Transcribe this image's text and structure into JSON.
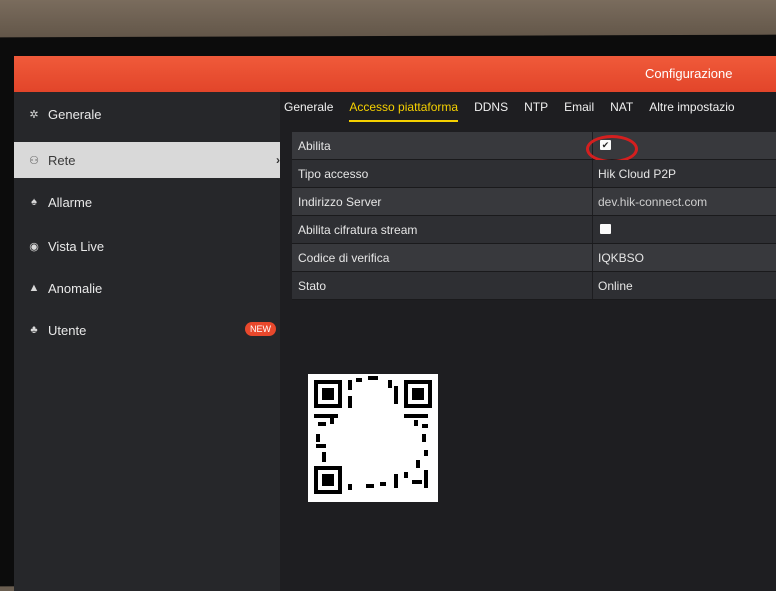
{
  "app": {
    "title": "Configurazione"
  },
  "sidebar": {
    "items": [
      {
        "label": "Generale",
        "icon": "gear-icon"
      },
      {
        "label": "Rete",
        "icon": "network-icon",
        "active": true
      },
      {
        "label": "Allarme",
        "icon": "alarm-icon"
      },
      {
        "label": "Vista Live",
        "icon": "eye-icon"
      },
      {
        "label": "Anomalie",
        "icon": "warning-icon"
      },
      {
        "label": "Utente",
        "icon": "users-icon",
        "badge": "NEW"
      }
    ]
  },
  "tabs": [
    "Generale",
    "Accesso piattaforma",
    "DDNS",
    "NTP",
    "Email",
    "NAT",
    "Altre impostazio"
  ],
  "active_tab": "Accesso piattaforma",
  "form": {
    "rows": [
      {
        "label": "Abilita",
        "type": "checkbox",
        "checked": true
      },
      {
        "label": "Tipo accesso",
        "value": "Hik Cloud P2P"
      },
      {
        "label": "Indirizzo Server",
        "value": "dev.hik-connect.com"
      },
      {
        "label": "Abilita cifratura stream",
        "type": "checkbox",
        "checked": false
      },
      {
        "label": "Codice di verifica",
        "value": "IQKBSO"
      },
      {
        "label": "Stato",
        "value": "Online"
      }
    ]
  },
  "colors": {
    "topbar": "#e2452a",
    "active_tab": "#f5d000",
    "highlight_ring": "#d41f1f",
    "badge": "#e8482c"
  }
}
